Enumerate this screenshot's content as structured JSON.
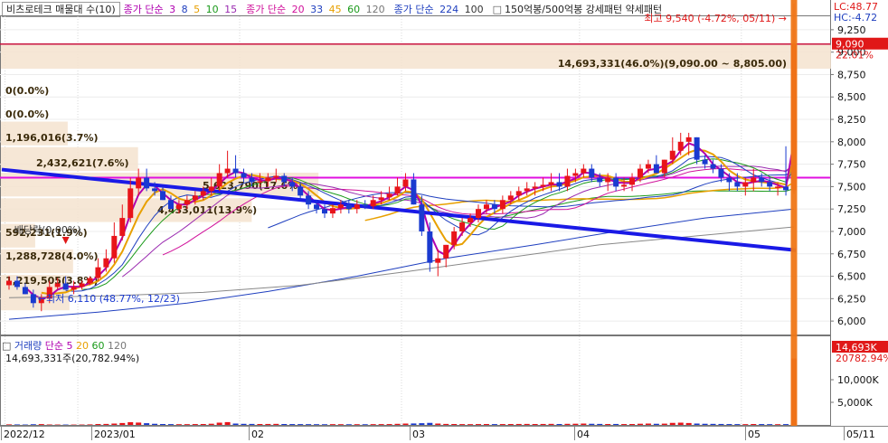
{
  "legend": {
    "stock_name": "비츠로테크 매물대 수(10)",
    "ma_short_label": "종가 단순",
    "ma_short_periods": [
      "3",
      "8",
      "5",
      "10",
      "15"
    ],
    "ma_short_colors": [
      "#b000b0",
      "#1f3fbf",
      "#e8a000",
      "#1a9a1a",
      "#9a2ab0"
    ],
    "ma_mid_label": "종가 단순",
    "ma_mid_periods": [
      "20",
      "33",
      "45",
      "60",
      "120"
    ],
    "ma_mid_colors": [
      "#d0109a",
      "#1f3fbf",
      "#e8a000",
      "#1a9a1a",
      "#777777"
    ],
    "ma_long_label": "종가 단순",
    "ma_long_periods": [
      "224",
      "100"
    ],
    "ma_long_colors": [
      "#1f3fbf",
      "#333333"
    ],
    "pattern_label": "150억봉/500억봉 강세패턴  약세패턴"
  },
  "right_top": {
    "lc": "LC:48.77",
    "hc": "HC:-4.72"
  },
  "price_axis": {
    "current_price": "9,090",
    "current_pct": "22.01%",
    "ticks": [
      "9,250",
      "9,000",
      "8,750",
      "8,500",
      "8,250",
      "8,000",
      "7,750",
      "7,500",
      "7,250",
      "7,000",
      "6,750",
      "6,500",
      "6,250",
      "6,000"
    ]
  },
  "volume_axis": {
    "current": "14,693K",
    "current_pct": "20782.94%",
    "ticks": [
      "10,000K",
      "5,000K"
    ]
  },
  "x_axis": {
    "labels": [
      "2022/12",
      "2023/01",
      "02",
      "03",
      "04",
      "05",
      "05/11"
    ]
  },
  "annotations": {
    "high": "최고 9,540 (-4.72%, 05/11)",
    "low": "최저 6,110 (48.77%, 12/23)",
    "dividend": "배당락(0.00%)"
  },
  "volume_profile": [
    {
      "text": "14,693,331(46.0%)(9,090.00 ~ 8,805.00)"
    },
    {
      "text": "0(0.0%)"
    },
    {
      "text": "0(0.0%)"
    },
    {
      "text": "1,196,016(3.7%)"
    },
    {
      "text": "2,432,621(7.6%)"
    },
    {
      "text": "5,623,790(17.6%)"
    },
    {
      "text": "4,433,011(13.9%)"
    },
    {
      "text": "592,231(1.9%)"
    },
    {
      "text": "1,288,728(4.0%)"
    },
    {
      "text": "1,219,505(3.8%)"
    }
  ],
  "volume_panel": {
    "legend_label": "거래량",
    "legend_ma_label": "단순",
    "legend_periods": [
      "5",
      "20",
      "60",
      "120"
    ],
    "legend_colors": [
      "#b000b0",
      "#e8a000",
      "#1a9a1a",
      "#777777"
    ],
    "current_value": "14,693,331주(20,782.94%)"
  },
  "chart_data": {
    "type": "candlestick",
    "ylim": [
      5850,
      9400
    ],
    "dates": [
      "2022/12/19",
      "2022/12/20",
      "2022/12/21",
      "2022/12/22",
      "2022/12/23",
      "2022/12/26",
      "2022/12/27",
      "2022/12/28",
      "2022/12/29",
      "2023/01/02",
      "2023/01/03",
      "2023/01/04",
      "2023/01/05",
      "2023/01/06",
      "2023/01/09",
      "2023/01/10",
      "2023/01/11",
      "2023/01/12",
      "2023/01/13",
      "2023/01/16",
      "2023/01/17",
      "2023/01/18",
      "2023/01/19",
      "2023/01/20",
      "2023/01/25",
      "2023/01/26",
      "2023/01/27",
      "2023/01/30",
      "2023/01/31",
      "2023/02/01",
      "2023/02/02",
      "2023/02/03",
      "2023/02/06",
      "2023/02/07",
      "2023/02/08",
      "2023/02/09",
      "2023/02/10",
      "2023/02/13",
      "2023/02/14",
      "2023/02/15",
      "2023/02/16",
      "2023/02/17",
      "2023/02/20",
      "2023/02/21",
      "2023/02/22",
      "2023/02/23",
      "2023/02/24",
      "2023/02/27",
      "2023/02/28",
      "2023/03/02",
      "2023/03/03",
      "2023/03/06",
      "2023/03/07",
      "2023/03/08",
      "2023/03/09",
      "2023/03/10",
      "2023/03/13",
      "2023/03/14",
      "2023/03/15",
      "2023/03/16",
      "2023/03/17",
      "2023/03/20",
      "2023/03/21",
      "2023/03/22",
      "2023/03/23",
      "2023/03/24",
      "2023/03/27",
      "2023/03/28",
      "2023/03/29",
      "2023/03/30",
      "2023/03/31",
      "2023/04/03",
      "2023/04/04",
      "2023/04/05",
      "2023/04/06",
      "2023/04/07",
      "2023/04/10",
      "2023/04/11",
      "2023/04/12",
      "2023/04/13",
      "2023/04/14",
      "2023/04/17",
      "2023/04/18",
      "2023/04/19",
      "2023/04/20",
      "2023/04/21",
      "2023/04/24",
      "2023/04/25",
      "2023/04/26",
      "2023/04/27",
      "2023/04/28",
      "2023/05/02",
      "2023/05/03",
      "2023/05/04",
      "2023/05/08",
      "2023/05/09",
      "2023/05/10",
      "2023/05/11"
    ],
    "open": [
      6400,
      6450,
      6380,
      6300,
      6200,
      6250,
      6380,
      6420,
      6350,
      6380,
      6420,
      6480,
      6600,
      6700,
      6950,
      7150,
      7480,
      7600,
      7480,
      7450,
      7350,
      7250,
      7300,
      7350,
      7400,
      7450,
      7500,
      7650,
      7700,
      7650,
      7600,
      7550,
      7560,
      7600,
      7620,
      7550,
      7500,
      7400,
      7300,
      7250,
      7200,
      7260,
      7300,
      7250,
      7300,
      7280,
      7350,
      7380,
      7420,
      7500,
      7580,
      7300,
      7000,
      6650,
      6700,
      6850,
      7000,
      7100,
      7150,
      7250,
      7300,
      7250,
      7350,
      7400,
      7450,
      7480,
      7500,
      7520,
      7550,
      7500,
      7620,
      7650,
      7700,
      7600,
      7550,
      7600,
      7500,
      7520,
      7600,
      7700,
      7750,
      7650,
      7800,
      7900,
      8000,
      8050,
      7800,
      7750,
      7700,
      7600,
      7550,
      7500,
      7550,
      7600,
      7550,
      7500,
      7500,
      7460
    ],
    "high": [
      6500,
      6500,
      6420,
      6350,
      6300,
      6450,
      6480,
      6500,
      6450,
      6450,
      6500,
      6700,
      6800,
      7100,
      7300,
      7600,
      7700,
      7700,
      7550,
      7500,
      7400,
      7350,
      7400,
      7450,
      7500,
      7600,
      7750,
      7900,
      7850,
      7700,
      7650,
      7650,
      7650,
      7700,
      7650,
      7600,
      7550,
      7450,
      7350,
      7300,
      7300,
      7350,
      7350,
      7350,
      7350,
      7400,
      7450,
      7500,
      7600,
      7650,
      7650,
      7400,
      7100,
      6800,
      6850,
      7050,
      7150,
      7200,
      7300,
      7350,
      7350,
      7400,
      7450,
      7500,
      7550,
      7550,
      7600,
      7650,
      7650,
      7700,
      7700,
      7750,
      7750,
      7650,
      7650,
      7650,
      7600,
      7650,
      7750,
      7800,
      7850,
      7800,
      8050,
      8100,
      8100,
      8050,
      7850,
      7800,
      7750,
      7650,
      7650,
      7600,
      7700,
      7650,
      7600,
      7550,
      7950,
      9540
    ],
    "low": [
      6350,
      6350,
      6300,
      6150,
      6110,
      6200,
      6350,
      6350,
      6300,
      6350,
      6400,
      6450,
      6550,
      6650,
      6900,
      7100,
      7400,
      7450,
      7400,
      7350,
      7250,
      7200,
      7250,
      7300,
      7350,
      7400,
      7450,
      7600,
      7600,
      7550,
      7500,
      7500,
      7500,
      7550,
      7500,
      7450,
      7350,
      7250,
      7200,
      7150,
      7150,
      7200,
      7200,
      7200,
      7250,
      7250,
      7300,
      7350,
      7400,
      7450,
      7300,
      6950,
      6550,
      6500,
      6600,
      6800,
      6950,
      7050,
      7100,
      7200,
      7200,
      7200,
      7300,
      7350,
      7400,
      7400,
      7450,
      7450,
      7450,
      7450,
      7550,
      7600,
      7550,
      7500,
      7450,
      7450,
      7450,
      7450,
      7550,
      7650,
      7650,
      7600,
      7750,
      7850,
      7850,
      7750,
      7700,
      7650,
      7550,
      7450,
      7450,
      7400,
      7450,
      7500,
      7450,
      7400,
      7400,
      7420
    ],
    "close": [
      6450,
      6380,
      6300,
      6200,
      6250,
      6380,
      6420,
      6350,
      6380,
      6420,
      6480,
      6600,
      6700,
      6950,
      7150,
      7480,
      7600,
      7480,
      7450,
      7350,
      7250,
      7300,
      7350,
      7400,
      7450,
      7500,
      7650,
      7700,
      7650,
      7600,
      7550,
      7560,
      7600,
      7620,
      7550,
      7500,
      7400,
      7300,
      7250,
      7200,
      7260,
      7300,
      7250,
      7300,
      7280,
      7350,
      7380,
      7420,
      7500,
      7580,
      7300,
      7000,
      6650,
      6700,
      6850,
      7000,
      7100,
      7150,
      7250,
      7300,
      7250,
      7350,
      7400,
      7450,
      7480,
      7500,
      7520,
      7550,
      7500,
      7620,
      7650,
      7700,
      7600,
      7550,
      7600,
      7500,
      7520,
      7600,
      7700,
      7750,
      7650,
      7800,
      7900,
      8000,
      8050,
      7800,
      7750,
      7700,
      7600,
      7550,
      7500,
      7550,
      7600,
      7550,
      7500,
      7500,
      7460,
      9090
    ],
    "volume": [
      120,
      110,
      90,
      150,
      180,
      100,
      90,
      85,
      80,
      90,
      120,
      200,
      220,
      300,
      420,
      600,
      520,
      380,
      250,
      200,
      180,
      160,
      170,
      190,
      200,
      260,
      500,
      620,
      300,
      240,
      220,
      200,
      210,
      230,
      200,
      190,
      180,
      170,
      160,
      150,
      170,
      160,
      150,
      160,
      150,
      170,
      180,
      190,
      240,
      300,
      320,
      380,
      450,
      300,
      220,
      200,
      180,
      170,
      190,
      200,
      180,
      190,
      200,
      210,
      220,
      200,
      210,
      230,
      200,
      240,
      260,
      300,
      250,
      220,
      200,
      210,
      190,
      200,
      260,
      300,
      250,
      280,
      450,
      500,
      420,
      300,
      250,
      230,
      210,
      190,
      180,
      170,
      200,
      190,
      170,
      160,
      180,
      14693
    ],
    "resistance_line": {
      "start": {
        "date": "2022/12/19",
        "value": 7690
      },
      "end": {
        "date": "2023/05/11",
        "value": 6790
      }
    },
    "horizontal_lines": [
      {
        "value": 9090,
        "color": "#c8103a"
      },
      {
        "value": 7600,
        "color": "#e010e0"
      }
    ],
    "volume_max": 16000
  }
}
